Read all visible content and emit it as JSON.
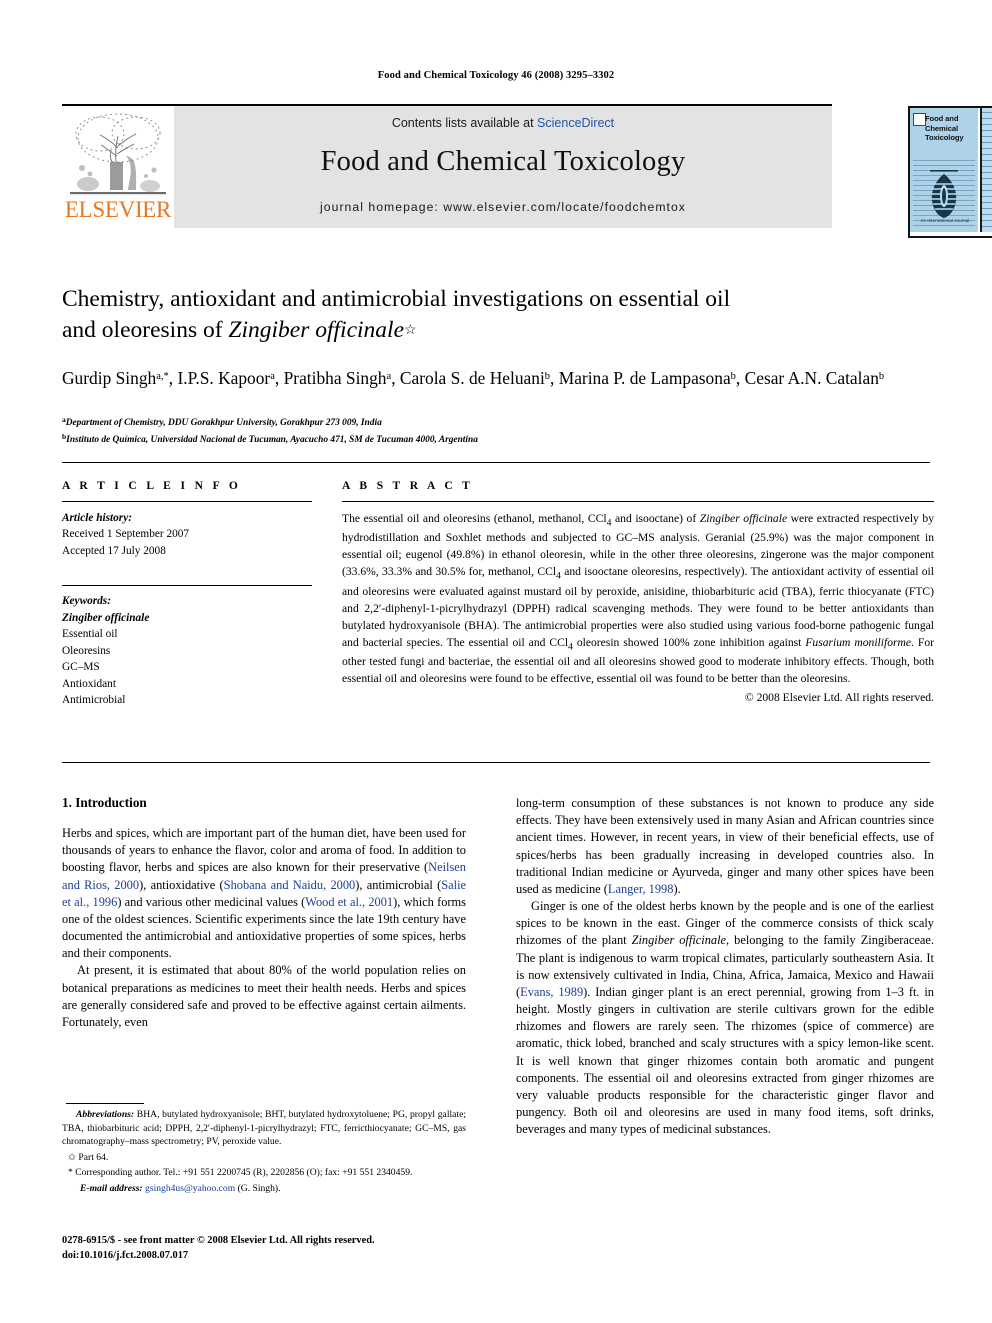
{
  "running_head": "Food and Chemical Toxicology 46 (2008) 3295–3302",
  "header": {
    "contents_prefix": "Contents lists available at ",
    "sciencedirect": "ScienceDirect",
    "journal_title": "Food and Chemical Toxicology",
    "homepage": "journal homepage: www.elsevier.com/locate/foodchemtox",
    "elsevier_wordmark": "ELSEVIER",
    "elsevier_accent_color": "#E87722",
    "link_color": "#2255aa",
    "band_color": "#e3e3e3"
  },
  "cover": {
    "title": "Food and Chemical Toxicology",
    "caption": "An International Journal",
    "background_color": "#aed3e8"
  },
  "article": {
    "title_line1": "Chemistry, antioxidant and antimicrobial investigations on essential oil",
    "title_line2_pre": "and oleoresins of ",
    "title_species": "Zingiber officinale",
    "title_footnote_mark": "☆",
    "authors": [
      {
        "name": "Gurdip Singh",
        "marks": "a,*",
        "sep": ", "
      },
      {
        "name": "I.P.S. Kapoor",
        "marks": "a",
        "sep": ", "
      },
      {
        "name": "Pratibha Singh",
        "marks": "a",
        "sep": ", "
      },
      {
        "name": "Carola S. de Heluani",
        "marks": "b",
        "sep": ", "
      },
      {
        "name": "Marina P. de Lampasona",
        "marks": "b",
        "sep": ", "
      },
      {
        "name": "Cesar A.N. Catalan",
        "marks": "b",
        "sep": ""
      }
    ],
    "affiliations": [
      {
        "mark": "a",
        "text": "Department of Chemistry, DDU Gorakhpur University, Gorakhpur 273 009, India"
      },
      {
        "mark": "b",
        "text": "Instituto de Química, Universidad Nacional de Tucuman, Ayacucho 471, SM de Tucuman 4000, Argentina"
      }
    ]
  },
  "article_info": {
    "heading": "A R T I C L E   I N F O",
    "history_label": "Article history:",
    "received": "Received 1 September 2007",
    "accepted": "Accepted 17 July 2008",
    "keywords_label": "Keywords:",
    "keywords": [
      "Zingiber officinale",
      "Essential oil",
      "Oleoresins",
      "GC–MS",
      "Antioxidant",
      "Antimicrobial"
    ],
    "keyword_italic_index": 0
  },
  "abstract": {
    "heading": "A B S T R A C T",
    "segments": [
      {
        "t": "The essential oil and oleoresins (ethanol, methanol, CCl",
        "s": "plain"
      },
      {
        "t": "4",
        "s": "sub"
      },
      {
        "t": " and isooctane) of ",
        "s": "plain"
      },
      {
        "t": "Zingiber officinale",
        "s": "italic"
      },
      {
        "t": " were extracted respectively by hydrodistillation and Soxhlet methods and subjected to GC–MS analysis. Geranial (25.9%) was the major component in essential oil; eugenol (49.8%) in ethanol oleoresin, while in the other three oleoresins, zingerone was the major component (33.6%, 33.3% and 30.5% for, methanol, CCl",
        "s": "plain"
      },
      {
        "t": "4",
        "s": "sub"
      },
      {
        "t": " and isooctane oleoresins, respectively). The antioxidant activity of essential oil and oleoresins were evaluated against mustard oil by peroxide, anisidine, thiobarbituric acid (TBA), ferric thiocyanate (FTC) and 2,2′-diphenyl-1-picrylhydrazyl (DPPH) radical scavenging methods. They were found to be better antioxidants than butylated hydroxyanisole (BHA). The antimicrobial properties were also studied using various food-borne pathogenic fungal and bacterial species. The essential oil and CCl",
        "s": "plain"
      },
      {
        "t": "4",
        "s": "sub"
      },
      {
        "t": " oleoresin showed 100% zone inhibition against ",
        "s": "plain"
      },
      {
        "t": "Fusarium moniliforme",
        "s": "italic"
      },
      {
        "t": ". For other tested fungi and bacteriae, the essential oil and all oleoresins showed good to moderate inhibitory effects. Though, both essential oil and oleoresins were found to be effective, essential oil was found to be better than the oleoresins.",
        "s": "plain"
      }
    ],
    "copyright": "© 2008 Elsevier Ltd. All rights reserved."
  },
  "body": {
    "section_title": "1. Introduction",
    "left_paragraphs": [
      [
        {
          "t": "Herbs and spices, which are important part of the human diet, have been used for thousands of years to enhance the flavor, color and aroma of food. In addition to boosting flavor, herbs and spices are also known for their preservative (",
          "s": "plain"
        },
        {
          "t": "Neilsen and Rios, 2000",
          "s": "ref"
        },
        {
          "t": "), antioxidative (",
          "s": "plain"
        },
        {
          "t": "Shobana and Naidu, 2000",
          "s": "ref"
        },
        {
          "t": "), antimicrobial (",
          "s": "plain"
        },
        {
          "t": "Salie et al., 1996",
          "s": "ref"
        },
        {
          "t": ") and various other medicinal values (",
          "s": "plain"
        },
        {
          "t": "Wood et al., 2001",
          "s": "ref"
        },
        {
          "t": "), which forms one of the oldest sciences. Scientific experiments since the late 19th century have documented the antimicrobial and antioxidative properties of some spices, herbs and their components.",
          "s": "plain"
        }
      ],
      [
        {
          "t": "At present, it is estimated that about 80% of the world population relies on botanical preparations as medicines to meet their health needs. Herbs and spices are generally considered safe and proved to be effective against certain ailments. Fortunately, even",
          "s": "plain"
        }
      ]
    ],
    "right_paragraphs": [
      [
        {
          "t": "long-term consumption of these substances is not known to produce any side effects. They have been extensively used in many Asian and African countries since ancient times. However, in recent years, in view of their beneficial effects, use of spices/herbs has been gradually increasing in developed countries also. In traditional Indian medicine or Ayurveda, ginger and many other spices have been used as medicine (",
          "s": "plain"
        },
        {
          "t": "Langer, 1998",
          "s": "ref"
        },
        {
          "t": ").",
          "s": "plain"
        }
      ],
      [
        {
          "t": "Ginger is one of the oldest herbs known by the people and is one of the earliest spices to be known in the east. Ginger of the commerce consists of thick scaly rhizomes of the plant ",
          "s": "plain"
        },
        {
          "t": "Zingiber officinale",
          "s": "italic"
        },
        {
          "t": ", belonging to the family Zingiberaceae. The plant is indigenous to warm tropical climates, particularly southeastern Asia. It is now extensively cultivated in India, China, Africa, Jamaica, Mexico and Hawaii (",
          "s": "plain"
        },
        {
          "t": "Evans, 1989",
          "s": "ref"
        },
        {
          "t": "). Indian ginger plant is an erect perennial, growing from 1–3 ft. in height. Mostly gingers in cultivation are sterile cultivars grown for the edible rhizomes and flowers are rarely seen. The rhizomes (spice of commerce) are aromatic, thick lobed, branched and scaly structures with a spicy lemon-like scent. It is well known that ginger rhizomes contain both aromatic and pungent components. The essential oil and oleoresins extracted from ginger rhizomes are very valuable products responsible for the characteristic ginger flavor and pungency. Both oil and oleoresins are used in many food items, soft drinks, beverages and many types of medicinal substances.",
          "s": "plain"
        }
      ]
    ]
  },
  "footnotes": {
    "abbrev_label": "Abbreviations:",
    "abbrev_text": " BHA, butylated hydroxyanisole; BHT, butylated hydroxytoluene; PG, propyl gallate; TBA, thiobarbituric acid; DPPH, 2,2′-diphenyl-1-picrylhydrazyl; FTC, ferricthiocyanate; GC–MS, gas chromatography–mass spectrometry; PV, peroxide value.",
    "part_note": "✩ Part 64.",
    "corresponding": "* Corresponding author. Tel.: +91 551 2200745 (R), 2202856 (O); fax: +91 551 2340459.",
    "email_label": "E-mail address:",
    "email": "gsingh4us@yahoo.com",
    "email_suffix": " (G. Singh)."
  },
  "imprint": {
    "line1": "0278-6915/$ - see front matter © 2008 Elsevier Ltd. All rights reserved.",
    "line2": "doi:10.1016/j.fct.2008.07.017"
  }
}
